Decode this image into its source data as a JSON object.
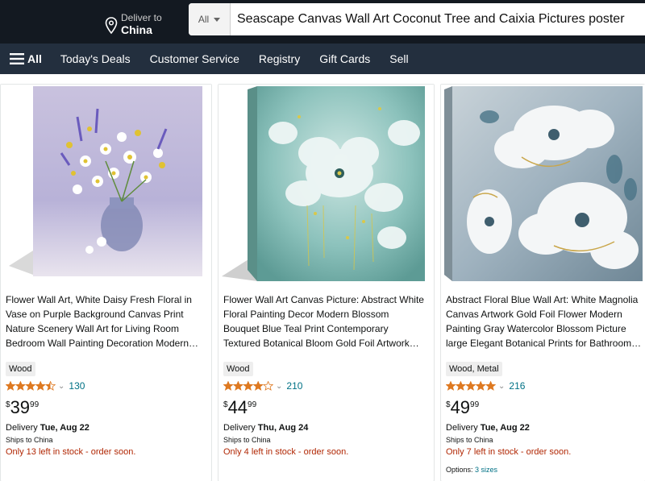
{
  "header": {
    "deliver_line1": "Deliver to",
    "deliver_line2": "China",
    "search_category": "All",
    "search_query": "Seascape Canvas Wall Art Coconut Tree and Caixia Pictures poster"
  },
  "nav": {
    "all_label": "All",
    "items": [
      "Today's Deals",
      "Customer Service",
      "Registry",
      "Gift Cards",
      "Sell"
    ]
  },
  "products": [
    {
      "title": "Flower Wall Art, White Daisy Fresh Floral in Vase on Purple Background Canvas Print Nature Scenery Wall Art for Living Room Bedroom Wall Painting Decoration Modern…",
      "material": "Wood",
      "stars": 4.5,
      "rating_count": "130",
      "price_symbol": "$",
      "price_whole": "39",
      "price_fraction": "99",
      "delivery_prefix": "Delivery ",
      "delivery_date": "Tue, Aug 22",
      "ships": "Ships to China",
      "stock": "Only 13 left in stock - order soon."
    },
    {
      "title": "Flower Wall Art Canvas Picture: Abstract White Floral Painting Decor Modern Blossom Bouquet Blue Teal Print Contemporary Textured Botanical Bloom Gold Foil Artwork…",
      "material": "Wood",
      "stars": 4.0,
      "rating_count": "210",
      "price_symbol": "$",
      "price_whole": "44",
      "price_fraction": "99",
      "delivery_prefix": "Delivery ",
      "delivery_date": "Thu, Aug 24",
      "ships": "Ships to China",
      "stock": "Only 4 left in stock - order soon."
    },
    {
      "title": "Abstract Floral Blue Wall Art: White Magnolia Canvas Artwork Gold Foil Flower Modern Painting Gray Watercolor Blossom Picture large Elegant Botanical Prints for Bathroom…",
      "material": "Wood, Metal",
      "stars": 5.0,
      "rating_count": "216",
      "price_symbol": "$",
      "price_whole": "49",
      "price_fraction": "99",
      "delivery_prefix": "Delivery ",
      "delivery_date": "Tue, Aug 22",
      "ships": "Ships to China",
      "stock": "Only 7 left in stock - order soon.",
      "options_label": "Options: ",
      "options_value": "3 sizes"
    }
  ],
  "colors": {
    "topbar": "#131921",
    "navbar": "#232f3e",
    "star": "#de7921",
    "link": "#007185",
    "stock": "#b12704"
  }
}
